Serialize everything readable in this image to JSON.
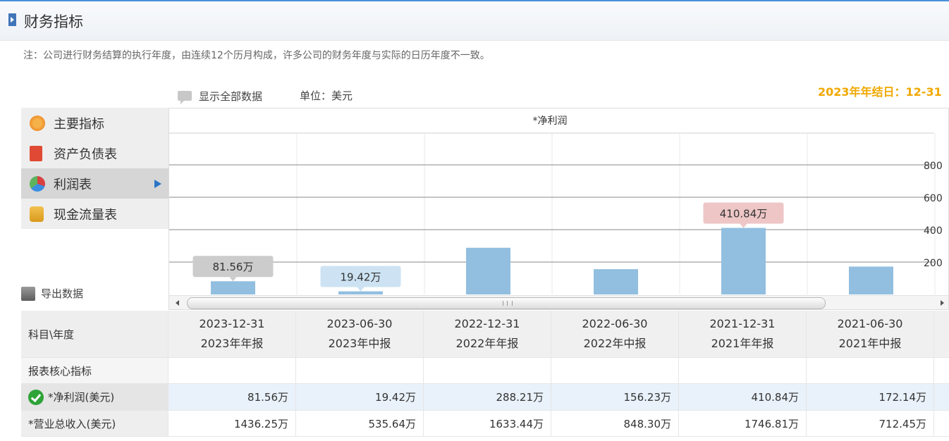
{
  "header": {
    "title": "财务指标"
  },
  "note": "注：公司进行财务结算的执行年度，由连续12个历月构成，许多公司的财务年度与实际的日历年度不一致。",
  "toolbar": {
    "show_all": "显示全部数据",
    "unit": "单位：美元",
    "fiscal_year_end": "2023年年结日：12-31"
  },
  "sidebar": {
    "items": [
      {
        "label": "主要指标",
        "icon": "gear-icon"
      },
      {
        "label": "资产负债表",
        "icon": "document-icon"
      },
      {
        "label": "利润表",
        "icon": "pie-chart-icon",
        "active": true
      },
      {
        "label": "现金流量表",
        "icon": "coins-icon"
      }
    ]
  },
  "export": {
    "label": "导出数据"
  },
  "chart_data": {
    "type": "bar",
    "title": "*净利润",
    "categories": [
      "2023-12-31",
      "2023-06-30",
      "2022-12-31",
      "2022-06-30",
      "2021-12-31",
      "2021-06-30"
    ],
    "values": [
      81.56,
      19.42,
      288.21,
      156.23,
      410.84,
      172.14
    ],
    "yticks": [
      200,
      400,
      600,
      800
    ],
    "ylim": [
      0,
      1000
    ],
    "bar_color": "#92bfe0",
    "tooltips": [
      {
        "index": 0,
        "label": "81.56万",
        "color": "#cccccc"
      },
      {
        "index": 1,
        "label": "19.42万",
        "color": "#cde3f3"
      },
      {
        "index": 4,
        "label": "410.84万",
        "color": "#eec6c6"
      }
    ],
    "grid": true
  },
  "table": {
    "header_label": "科目\\年度",
    "columns": [
      {
        "date": "2023-12-31",
        "report": "2023年年报"
      },
      {
        "date": "2023-06-30",
        "report": "2023年中报"
      },
      {
        "date": "2022-12-31",
        "report": "2022年年报"
      },
      {
        "date": "2022-06-30",
        "report": "2022年中报"
      },
      {
        "date": "2021-12-31",
        "report": "2021年年报"
      },
      {
        "date": "2021-06-30",
        "report": "2021年中报"
      }
    ],
    "section_label": "报表核心指标",
    "rows": [
      {
        "label": "*净利润(美元)",
        "values": [
          "81.56万",
          "19.42万",
          "288.21万",
          "156.23万",
          "410.84万",
          "172.14万"
        ]
      },
      {
        "label": "*营业总收入(美元)",
        "values": [
          "1436.25万",
          "535.64万",
          "1633.44万",
          "848.30万",
          "1746.81万",
          "712.45万"
        ]
      }
    ]
  }
}
